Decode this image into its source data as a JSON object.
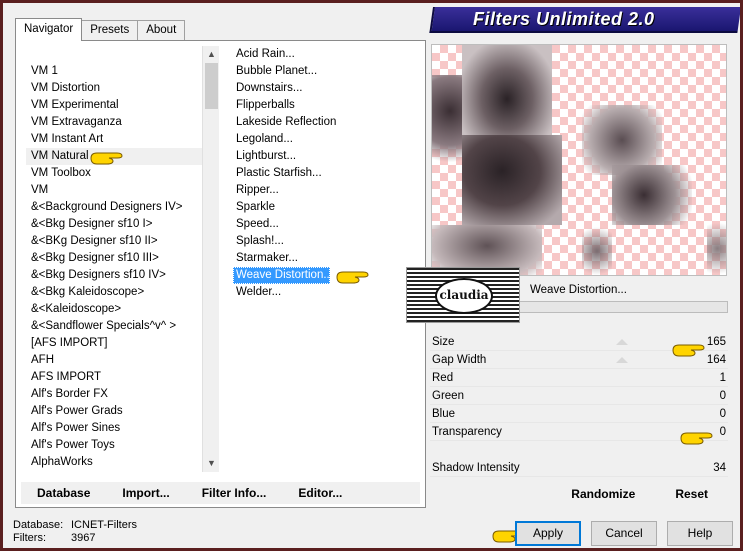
{
  "window": {
    "title": "Filters Unlimited 2.0"
  },
  "tabs": [
    {
      "label": "Navigator",
      "active": true
    },
    {
      "label": "Presets",
      "active": false
    },
    {
      "label": "About",
      "active": false
    }
  ],
  "categories": [
    "VM 1",
    "VM Distortion",
    "VM Experimental",
    "VM Extravaganza",
    "VM Instant Art",
    "VM Natural",
    "VM Toolbox",
    "VM",
    "&<Background Designers IV>",
    "&<Bkg Designer sf10 I>",
    "&<BKg Designer sf10 II>",
    "&<Bkg Designer sf10 III>",
    "&<Bkg Designers sf10 IV>",
    "&<Bkg Kaleidoscope>",
    "&<Kaleidoscope>",
    "&<Sandflower Specials^v^ >",
    "[AFS IMPORT]",
    "AFH",
    "AFS IMPORT",
    "Alf's Border FX",
    "Alf's Power Grads",
    "Alf's Power Sines",
    "Alf's Power Toys",
    "AlphaWorks"
  ],
  "selected_category": "VM Natural",
  "filters": [
    "Acid Rain...",
    "Bubble Planet...",
    "Downstairs...",
    "Flipperballs",
    "Lakeside Reflection",
    "Legoland...",
    "Lightburst...",
    "Plastic Starfish...",
    "Ripper...",
    "Sparkle",
    "Speed...",
    "Splash!...",
    "Starmaker...",
    "Weave Distortion...",
    "Welder..."
  ],
  "selected_filter": "Weave Distortion...",
  "panel_buttons": {
    "database": "Database",
    "import": "Import...",
    "filter_info": "Filter Info...",
    "editor": "Editor..."
  },
  "preview": {
    "filter_name": "Weave Distortion..."
  },
  "watermark": {
    "text": "claudia"
  },
  "params": [
    {
      "name": "Size",
      "value": "165"
    },
    {
      "name": "Gap Width",
      "value": "164"
    },
    {
      "name": "Red",
      "value": "1"
    },
    {
      "name": "Green",
      "value": "0"
    },
    {
      "name": "Blue",
      "value": "0"
    },
    {
      "name": "Transparency",
      "value": "0"
    },
    {
      "name": "",
      "value": ""
    },
    {
      "name": "Shadow Intensity",
      "value": "34"
    }
  ],
  "action_buttons": {
    "randomize": "Randomize",
    "reset": "Reset"
  },
  "status": {
    "database_label": "Database:",
    "database_value": "ICNET-Filters",
    "filters_label": "Filters:",
    "filters_value": "3967"
  },
  "dialog_buttons": {
    "apply": "Apply",
    "cancel": "Cancel",
    "help": "Help"
  },
  "colors": {
    "title_banner": "#2a2590",
    "selection": "#3399ff",
    "checker": "#f7c7c7",
    "frame": "#5a1f1f",
    "pointer_hand": "#ffd400"
  }
}
